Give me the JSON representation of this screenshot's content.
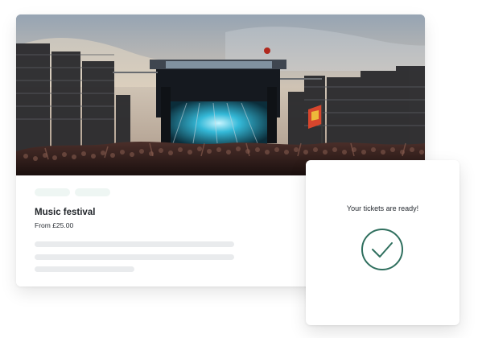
{
  "event": {
    "title": "Music festival",
    "price": "From £25.00",
    "hero_image": "festival-crowd-stage-photo",
    "tags": [
      "",
      ""
    ]
  },
  "ticket": {
    "message": "Your tickets are ready!",
    "icon": "check-circle-icon"
  },
  "colors": {
    "accent": "#2f6f5e",
    "tag_bg": "#eef6f3",
    "placeholder": "#e9ebed"
  }
}
